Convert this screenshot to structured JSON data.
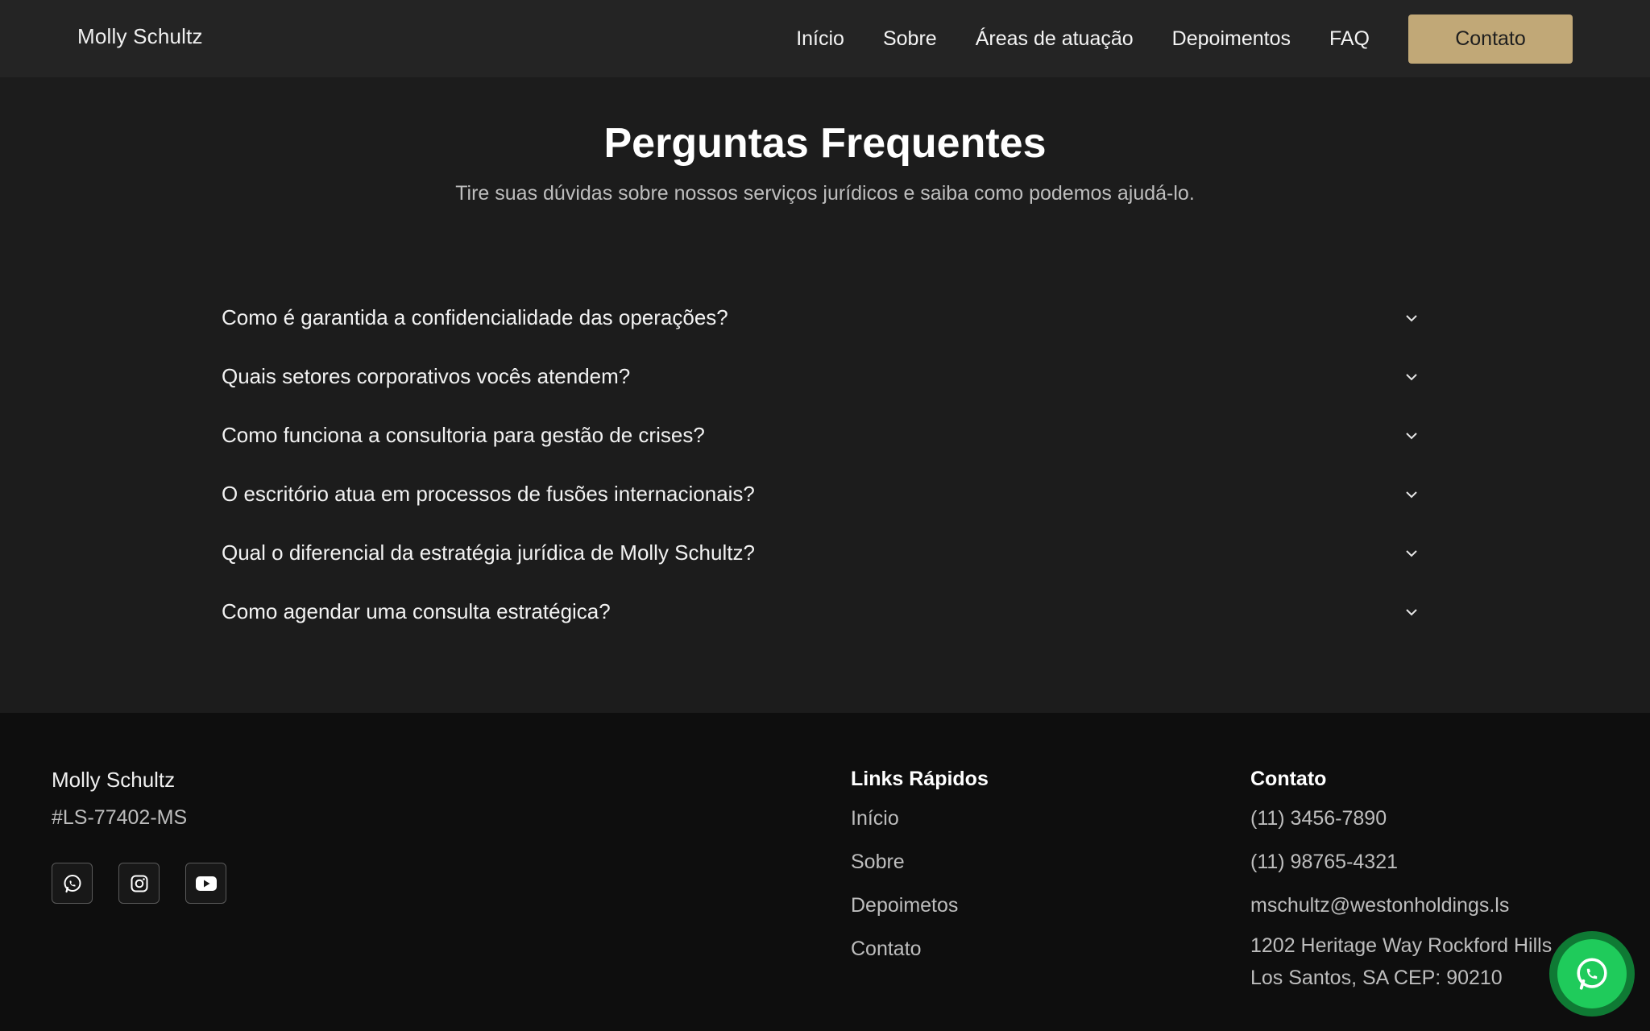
{
  "header": {
    "brand": "Molly Schultz",
    "nav": [
      "Início",
      "Sobre",
      "Áreas de atuação",
      "Depoimentos",
      "FAQ"
    ],
    "cta_label": "Contato",
    "accent_color": "#c1a877"
  },
  "faq": {
    "title": "Perguntas Frequentes",
    "subtitle": "Tire suas dúvidas sobre nossos serviços jurídicos e saiba como podemos ajudá-lo.",
    "questions": [
      "Como é garantida a confidencialidade das operações?",
      "Quais setores corporativos vocês atendem?",
      "Como funciona a consultoria para gestão de crises?",
      "O escritório atua em processos de fusões internacionais?",
      "Qual o diferencial da estratégia jurídica de Molly Schultz?",
      "Como agendar uma consulta estratégica?"
    ],
    "expand_icon": "chevron-down-icon"
  },
  "footer": {
    "brand": "Molly Schultz",
    "registration": "#LS-77402-MS",
    "social_icons": [
      "whatsapp-icon",
      "instagram-icon",
      "youtube-icon"
    ],
    "links_heading": "Links Rápidos",
    "links": [
      "Início",
      "Sobre",
      "Depoimetos",
      "Contato"
    ],
    "contact_heading": "Contato",
    "phone1": "(11) 3456-7890",
    "phone2": "(11) 98765-4321",
    "email": "mschultz@westonholdings.ls",
    "address_line1": "1202 Heritage Way Rockford Hills",
    "address_line2": "Los Santos, SA CEP: 90210"
  },
  "floating_button": {
    "icon": "whatsapp-icon",
    "color": "#1fcb5b"
  }
}
